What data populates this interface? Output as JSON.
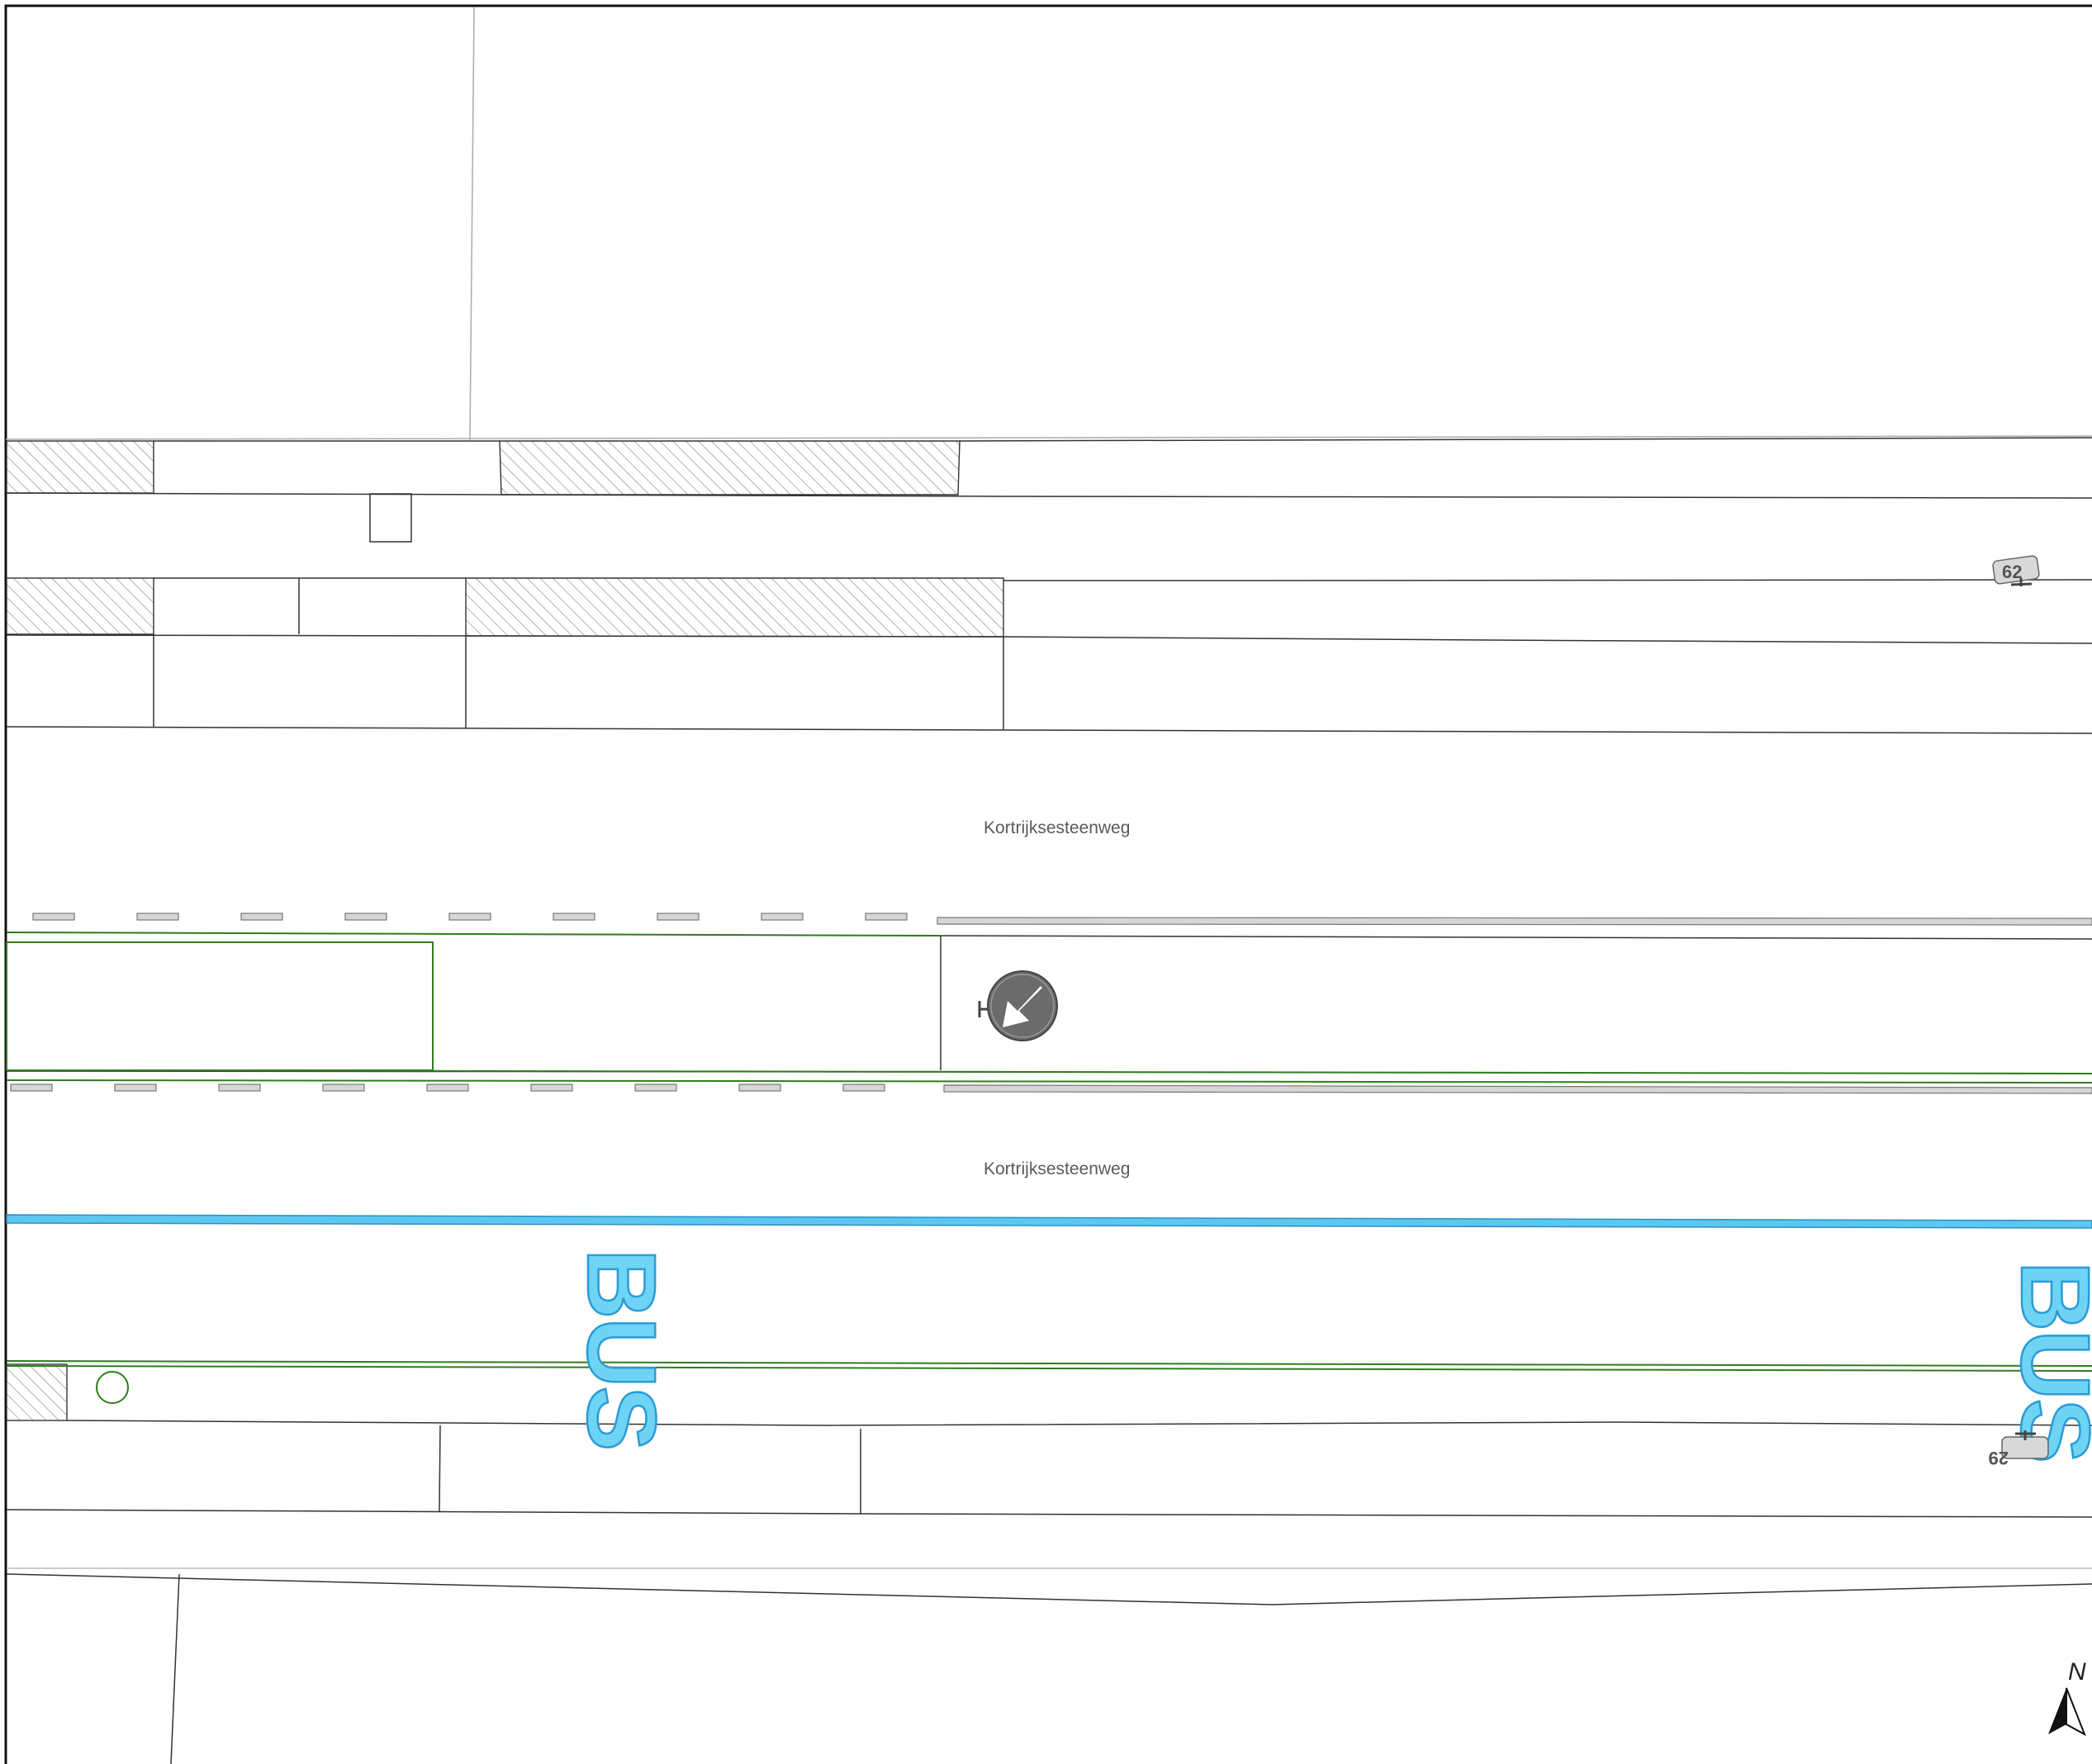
{
  "street": {
    "name_upper": "Kortrijksesteenweg",
    "name_lower": "Kortrijksesteenweg"
  },
  "bus_lane": {
    "marking_1": "BUS",
    "marking_2": "BUS",
    "color": "#6fd3f4"
  },
  "house_numbers": {
    "north": "62",
    "south": "29"
  },
  "north_arrow": {
    "label": "N"
  },
  "colors": {
    "lines": "#333333",
    "green_outline": "#2e7d1e",
    "bus_lane": "#5cc8f0",
    "sign": "#6b6b6b"
  },
  "icons": {
    "traffic_sign": "keep-left-arrow-sign",
    "tree": "tree-circle",
    "north": "north-arrow"
  }
}
